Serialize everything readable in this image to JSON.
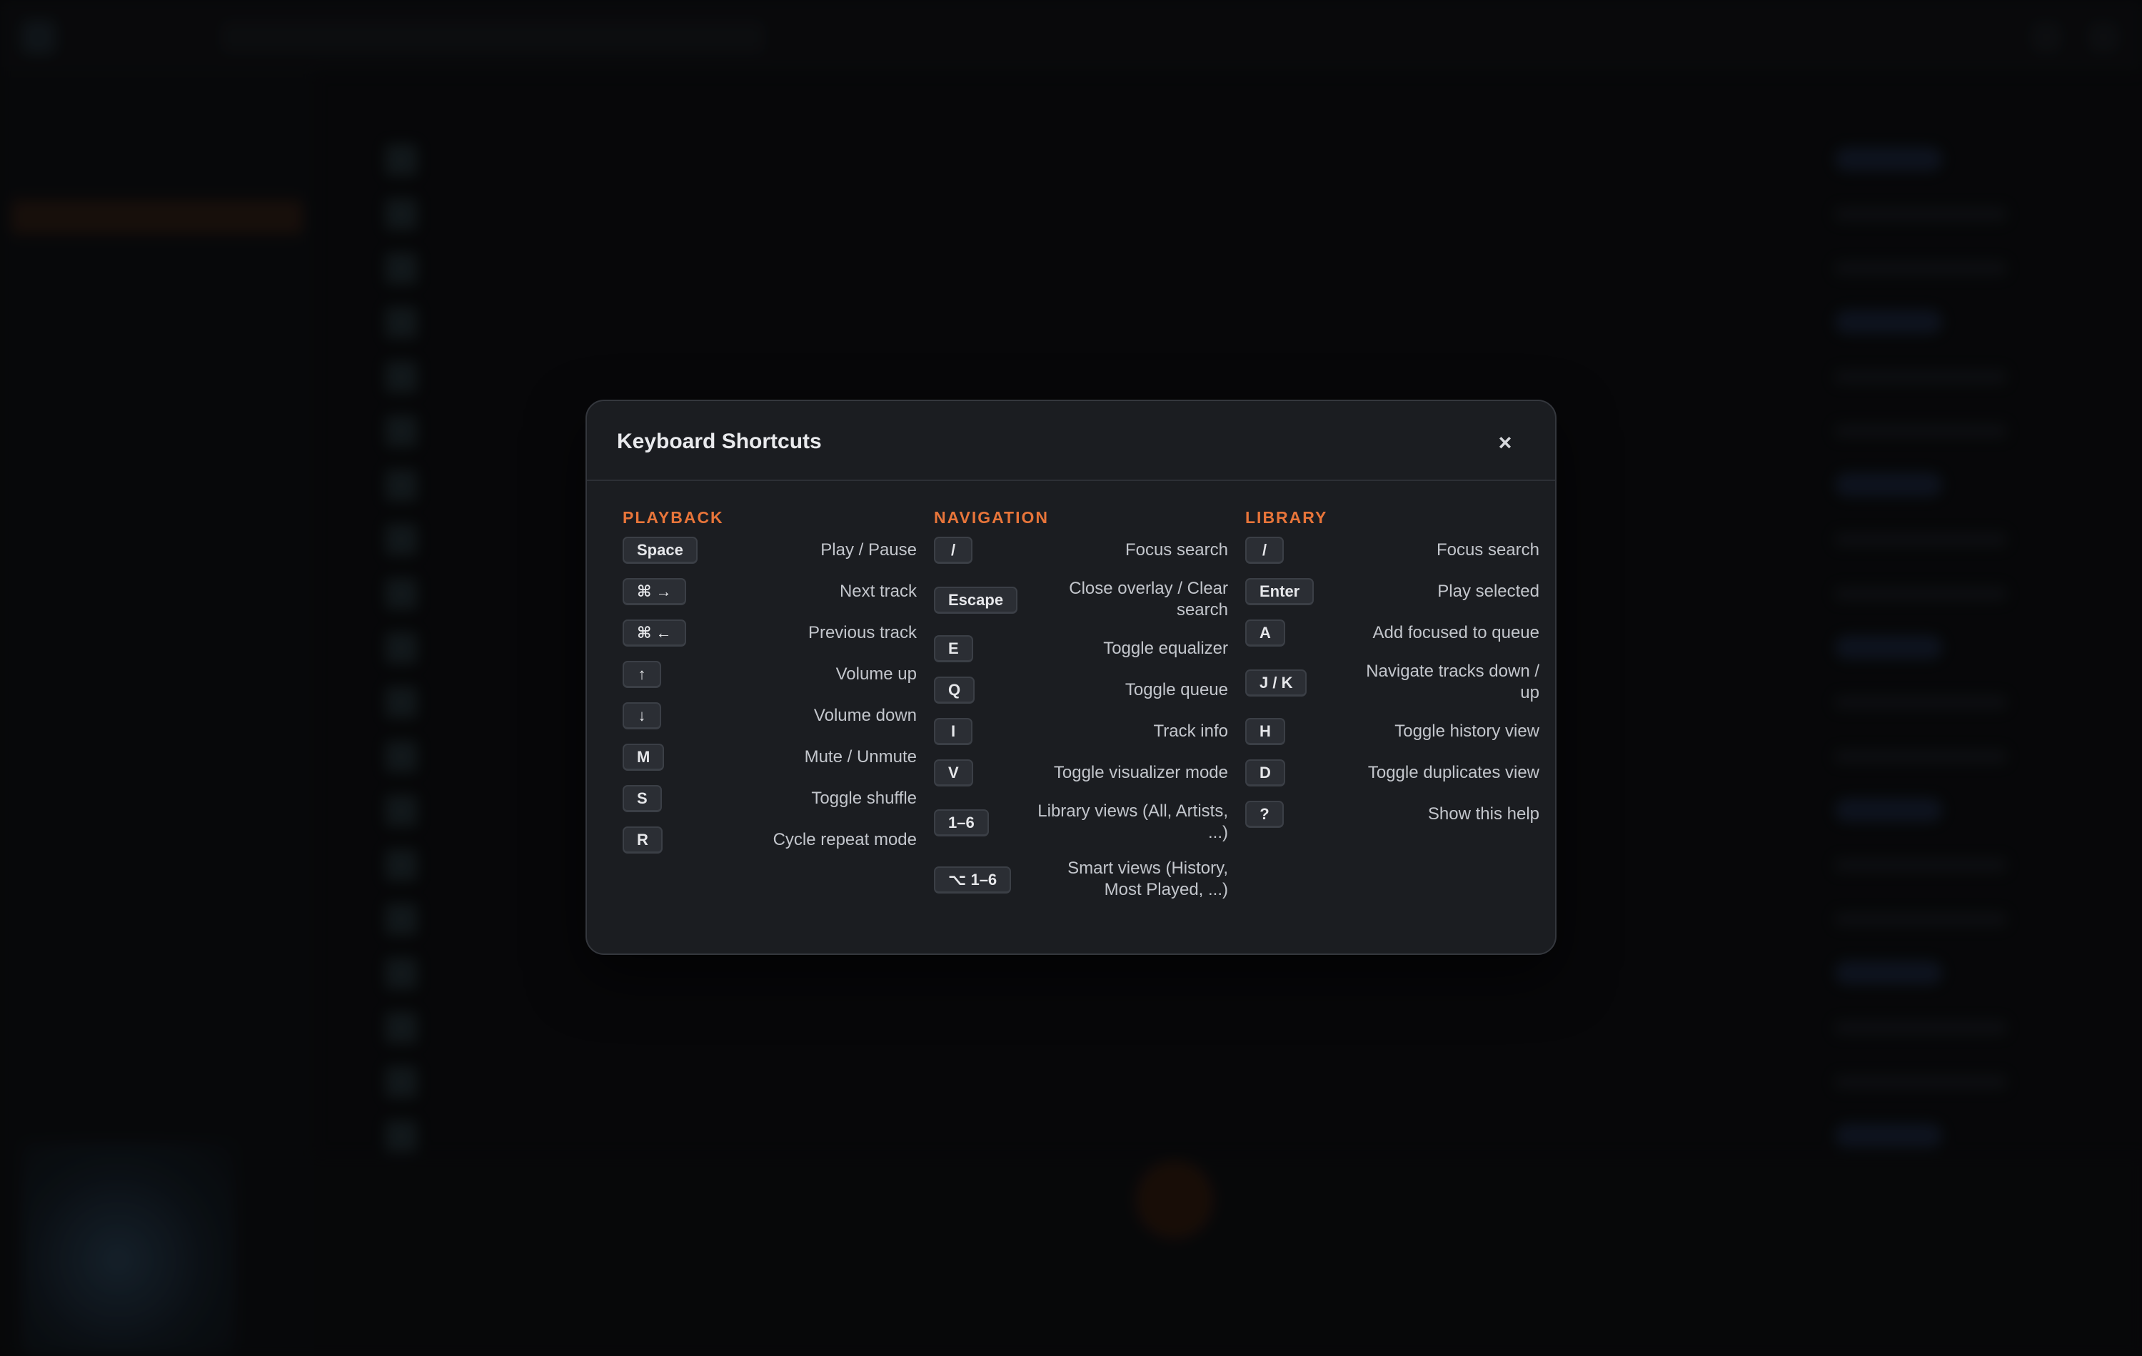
{
  "modal": {
    "title": "Keyboard Shortcuts",
    "close_icon": "close-icon",
    "columns": [
      {
        "heading": "PLAYBACK",
        "shortcuts": [
          {
            "key": "Space",
            "action": "Play / Pause"
          },
          {
            "key": "⌘ →",
            "action": "Next track"
          },
          {
            "key": "⌘ ←",
            "action": "Previous track"
          },
          {
            "key": "↑",
            "action": "Volume up"
          },
          {
            "key": "↓",
            "action": "Volume down"
          },
          {
            "key": "M",
            "action": "Mute / Unmute"
          },
          {
            "key": "S",
            "action": "Toggle shuffle"
          },
          {
            "key": "R",
            "action": "Cycle repeat mode"
          }
        ]
      },
      {
        "heading": "NAVIGATION",
        "shortcuts": [
          {
            "key": "/",
            "action": "Focus search"
          },
          {
            "key": "Escape",
            "action": "Close overlay / Clear search"
          },
          {
            "key": "E",
            "action": "Toggle equalizer"
          },
          {
            "key": "Q",
            "action": "Toggle queue"
          },
          {
            "key": "I",
            "action": "Track info"
          },
          {
            "key": "V",
            "action": "Toggle visualizer mode"
          },
          {
            "key": "1–6",
            "action": "Library views (All, Artists, ...)"
          },
          {
            "key": "⌥ 1–6",
            "action": "Smart views (History, Most Played, ...)"
          }
        ]
      },
      {
        "heading": "LIBRARY",
        "shortcuts": [
          {
            "key": "/",
            "action": "Focus search"
          },
          {
            "key": "Enter",
            "action": "Play selected"
          },
          {
            "key": "A",
            "action": "Add focused to queue"
          },
          {
            "key": "J / K",
            "action": "Navigate tracks down / up"
          },
          {
            "key": "H",
            "action": "Toggle history view"
          },
          {
            "key": "D",
            "action": "Toggle duplicates view"
          },
          {
            "key": "?",
            "action": "Show this help"
          }
        ]
      }
    ]
  },
  "colors": {
    "accent": "#e8753a",
    "modal_bg": "#1b1d21",
    "key_bg": "#2b2e34",
    "text": "#c3c6cc"
  }
}
